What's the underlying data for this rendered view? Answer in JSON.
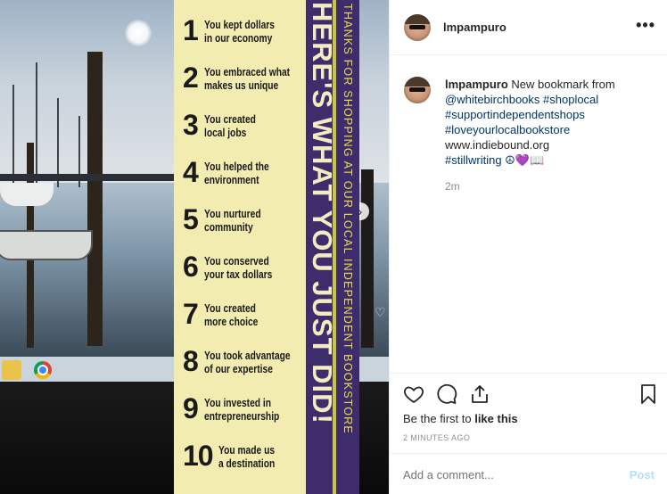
{
  "post": {
    "image": {
      "bookmark": {
        "items": [
          {
            "num": "1",
            "line1": "You kept dollars",
            "line2": "in our economy"
          },
          {
            "num": "2",
            "line1": "You embraced what",
            "line2": "makes us unique"
          },
          {
            "num": "3",
            "line1": "You created",
            "line2": "local jobs"
          },
          {
            "num": "4",
            "line1": "You helped the",
            "line2": "environment"
          },
          {
            "num": "5",
            "line1": "You  nurtured",
            "line2": "community"
          },
          {
            "num": "6",
            "line1": "You conserved",
            "line2": "your tax dollars"
          },
          {
            "num": "7",
            "line1": "You created",
            "line2": "more choice"
          },
          {
            "num": "8",
            "line1": "You took advantage",
            "line2": "of our expertise"
          },
          {
            "num": "9",
            "line1": "You invested in",
            "line2": "entrepreneurship"
          },
          {
            "num": "10",
            "line1": "You made us",
            "line2": "a destination"
          }
        ],
        "headline": "HERE'S WHAT YOU JUST DID!",
        "thanks": "THANKS FOR SHOPPING AT OUR LOCAL INDEPENDENT BOOKSTORE",
        "colors": {
          "cream": "#f2ecb1",
          "purple": "#3f2c6d",
          "yellow": "#e7dd47"
        }
      }
    },
    "header": {
      "username": "lmpampuro",
      "more_icon": "more-options-icon"
    },
    "caption": {
      "username": "lmpampuro",
      "text": "New bookmark from",
      "lines": [
        {
          "text": "@whitebirchbooks #shoplocal",
          "kind": "tag"
        },
        {
          "text": "#supportindependentshops",
          "kind": "tag"
        },
        {
          "text": "#loveyourlocalbookstore",
          "kind": "tag"
        },
        {
          "text": "www.indiebound.org",
          "kind": "plain"
        },
        {
          "text": "#stillwriting ☮💜📖",
          "kind": "mixed"
        }
      ],
      "time": "2m"
    },
    "actions": {
      "like_icon": "heart-icon",
      "comment_icon": "comment-icon",
      "share_icon": "share-icon",
      "save_icon": "bookmark-icon"
    },
    "likes": {
      "prefix": "Be the first to ",
      "bold": "like this"
    },
    "timestamp": "2 MINUTES AGO",
    "comment": {
      "placeholder": "Add a comment...",
      "post_label": "Post"
    },
    "colors": {
      "link": "#003569",
      "muted": "#8e8e8e",
      "post_button": "#b2dffc"
    }
  }
}
